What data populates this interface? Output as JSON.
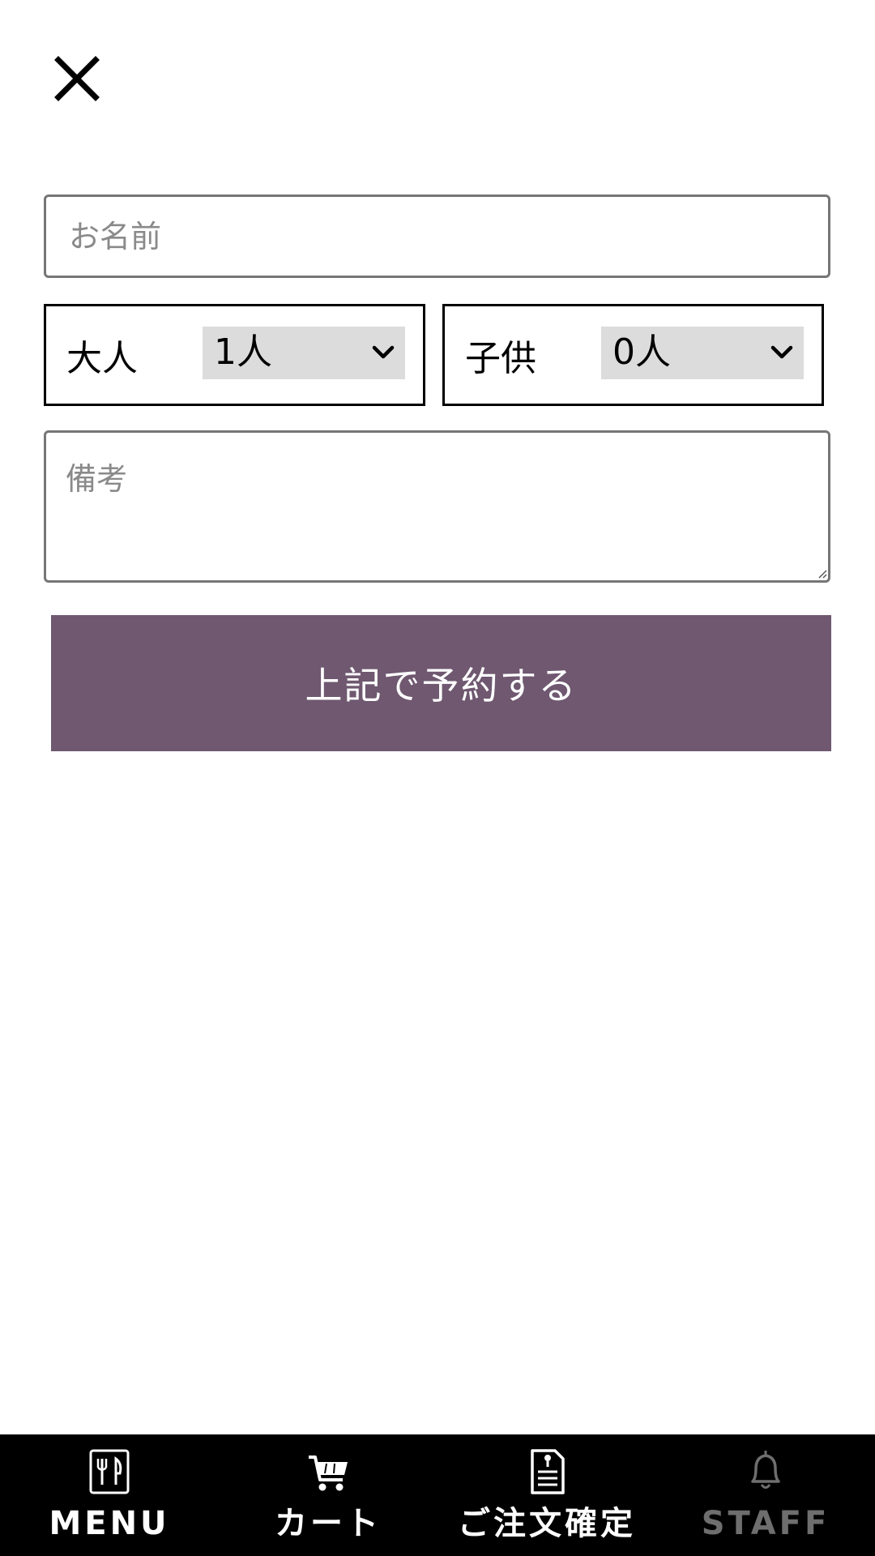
{
  "form": {
    "close_icon": "close-icon",
    "name_placeholder": "お名前",
    "adult": {
      "label": "大人",
      "value": "1人",
      "icon": "chevron-down-icon"
    },
    "child": {
      "label": "子供",
      "value": "0人",
      "icon": "chevron-down-icon"
    },
    "notes_placeholder": "備考",
    "submit_label": "上記で予約する"
  },
  "colors": {
    "accent": "#6f5870",
    "nav_background": "#000000",
    "select_background": "#dcdcdc",
    "disabled_nav": "#6e6e6e"
  },
  "bottom_nav": {
    "items": [
      {
        "label": "MENU",
        "icon": "menu-utensils-icon",
        "enabled": true
      },
      {
        "label": "カート",
        "icon": "cart-icon",
        "enabled": true
      },
      {
        "label": "ご注文確定",
        "icon": "order-document-icon",
        "enabled": true
      },
      {
        "label": "STAFF",
        "icon": "bell-icon",
        "enabled": false
      }
    ]
  }
}
